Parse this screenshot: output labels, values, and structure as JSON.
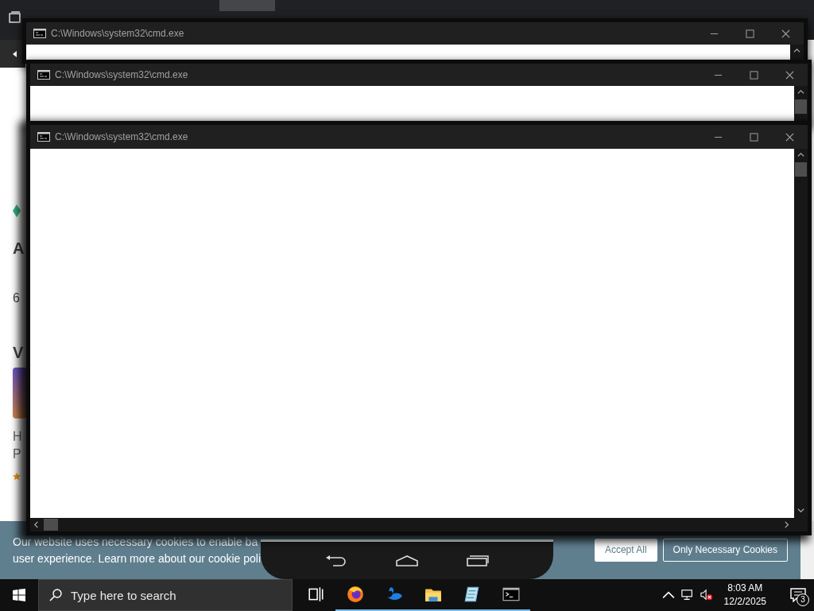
{
  "background_page": {
    "fragments": [
      "A",
      "6",
      "V",
      "H",
      "P"
    ],
    "cookie_banner": {
      "lines": [
        "Our website uses necessary cookies to enable ba",
        "user experience. Learn more about our cookie poli"
      ],
      "buttons": [
        "Accept All",
        "Only Necessary Cookies"
      ]
    }
  },
  "windows": [
    {
      "title": "C:\\Windows\\system32\\cmd.exe",
      "kind": "cmd"
    },
    {
      "title": "C:\\Windows\\system32\\cmd.exe",
      "kind": "cmd"
    },
    {
      "title": "C:\\Windows\\system32\\cmd.exe",
      "kind": "cmd"
    }
  ],
  "taskbar": {
    "search": {
      "placeholder": "Type here to search"
    },
    "apps": [
      {
        "kind": "taskview",
        "running": false
      },
      {
        "kind": "browser",
        "running": true
      },
      {
        "kind": "swan",
        "running": true
      },
      {
        "kind": "folder",
        "running": true
      },
      {
        "kind": "notepad",
        "running": true
      },
      {
        "kind": "terminal",
        "running": true
      }
    ],
    "clock": {
      "time": "8:03 AM",
      "date": "12/2/2025"
    },
    "notifications": "3"
  }
}
